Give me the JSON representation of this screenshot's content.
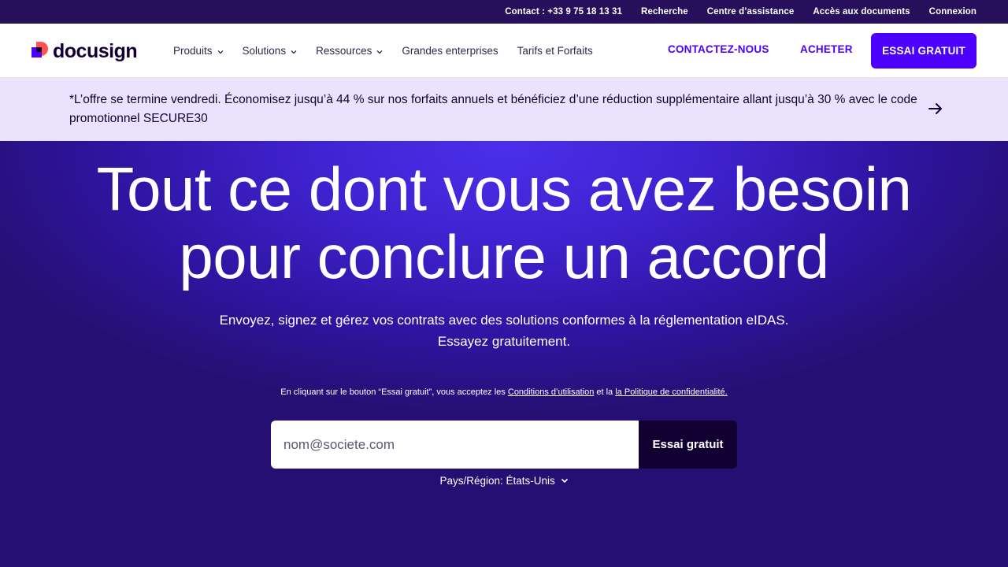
{
  "utility_bar": {
    "contact": "Contact : +33 9 75 18 13 31",
    "search": "Recherche",
    "help_center": "Centre d’assistance",
    "document_access": "Accès aux documents",
    "login": "Connexion"
  },
  "header": {
    "logo_text": "docusign",
    "nav": [
      {
        "label": "Produits",
        "has_dropdown": true
      },
      {
        "label": "Solutions",
        "has_dropdown": true
      },
      {
        "label": "Ressources",
        "has_dropdown": true
      },
      {
        "label": "Grandes enterprises",
        "has_dropdown": false
      },
      {
        "label": "Tarifs et Forfaits",
        "has_dropdown": false
      }
    ],
    "contact_label": "CONTACTEZ-NOUS",
    "buy_label": "ACHETER",
    "trial_label": "ESSAI GRATUIT",
    "icons": {
      "dropdown": "chevron-down-icon",
      "arrow": "arrow-right-icon"
    }
  },
  "promo": {
    "text": "*L’offre se termine vendredi. Économisez jusqu’à 44 % sur nos forfaits annuels et bénéficiez d’une réduction supplémentaire allant jusqu’à 30 % avec le code promotionnel SECURE30"
  },
  "hero": {
    "title_line1": "Tout ce dont vous avez besoin",
    "title_line2": "pour conclure un accord",
    "subtitle_line1": "Envoyez, signez et gérez vos contrats avec des solutions conformes à la réglementation eIDAS.",
    "subtitle_line2": "Essayez gratuitement.",
    "terms_prefix": "En cliquant sur le bouton “Essai gratuit”, vous acceptez les ",
    "terms_link": "Conditions d’utilisation",
    "terms_middle": " et la ",
    "privacy_link": "la Politique de confidentialité.",
    "email_placeholder": "nom@societe.com",
    "submit_label": "Essai gratuit",
    "region_label": "Pays/Région: États-Unis"
  },
  "colors": {
    "brand_purple": "#4c00ff",
    "dark_navy": "#130032",
    "promo_bg": "#ebe3fd",
    "logo_red": "#ff5252"
  }
}
